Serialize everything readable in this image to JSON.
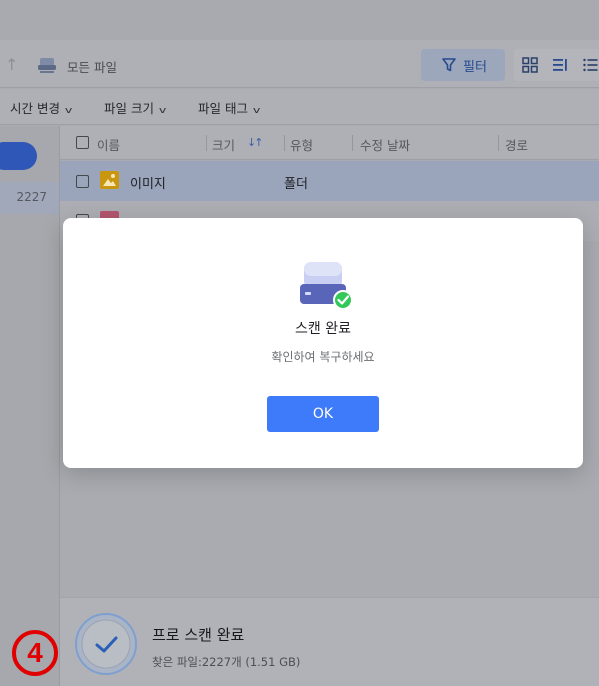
{
  "toolbar": {
    "path_label": "모든 파일",
    "filter_label": "필터"
  },
  "filters": [
    {
      "label": "시간 변경"
    },
    {
      "label": "파일 크기"
    },
    {
      "label": "파일 태그"
    }
  ],
  "sidebar": {
    "selected_count": "2227"
  },
  "table": {
    "columns": [
      "이름",
      "크기",
      "유형",
      "수정 날짜",
      "경로"
    ],
    "rows": [
      {
        "name": "이미지",
        "type": "폴더"
      }
    ]
  },
  "modal": {
    "title": "스캔 완료",
    "subtitle": "확인하여 복구하세요",
    "ok_label": "OK"
  },
  "status": {
    "title": "프로 스캔 완료",
    "subtitle": "찾은 파일:2227개 (1.51 GB)"
  },
  "annotation": {
    "step": "4"
  },
  "colors": {
    "accent": "#3d7bfa",
    "success": "#34c759",
    "annotation": "#e00000"
  }
}
